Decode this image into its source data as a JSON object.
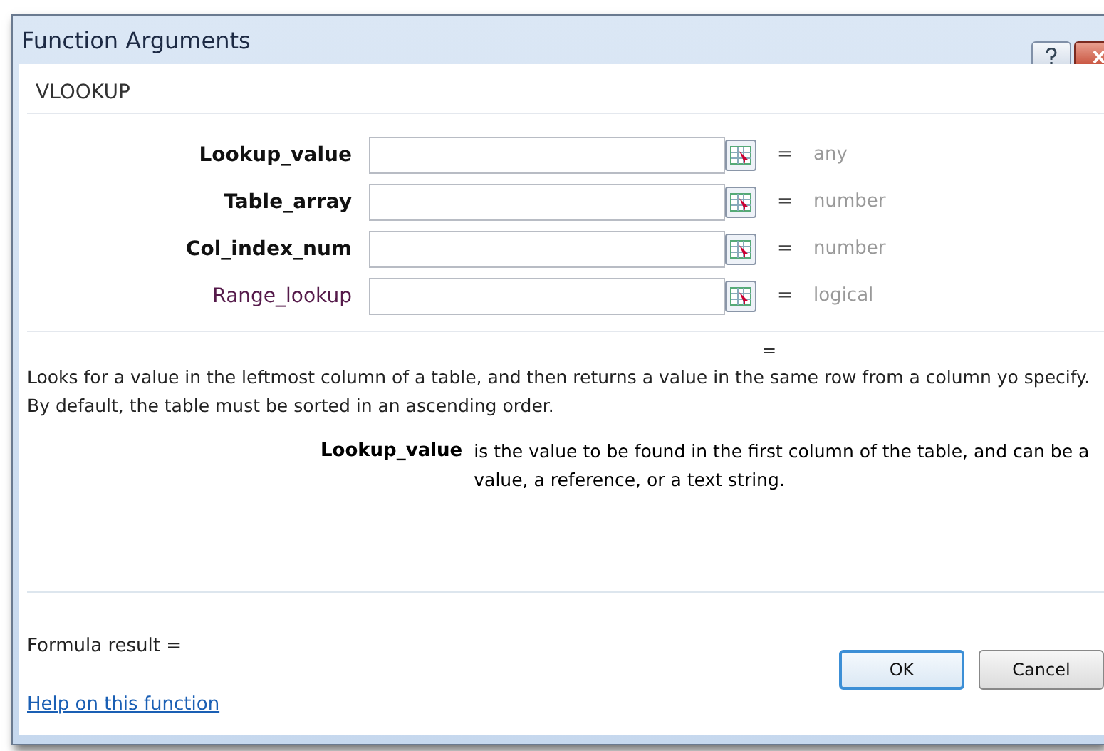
{
  "window": {
    "title": "Function Arguments"
  },
  "function_name": "VLOOKUP",
  "arguments": [
    {
      "name": "Lookup_value",
      "required": true,
      "equals": "=",
      "value_type": "any"
    },
    {
      "name": "Table_array",
      "required": true,
      "equals": "=",
      "value_type": "number"
    },
    {
      "name": "Col_index_num",
      "required": true,
      "equals": "=",
      "value_type": "number"
    },
    {
      "name": "Range_lookup",
      "required": false,
      "equals": "=",
      "value_type": "logical"
    }
  ],
  "result_sign": "=",
  "description": "Looks for a value in the leftmost column of a table, and then returns a value in the same row from a column yo specify. By default, the table must be sorted in an ascending order.",
  "argument_help": {
    "name": "Lookup_value",
    "text": "is the value to be found in the first column of the table, and can be a value, a reference, or a text string."
  },
  "formula_result": "Formula result =",
  "help_link": "Help on this function",
  "buttons": [
    {
      "label": "OK",
      "default": true
    },
    {
      "label": "Cancel",
      "default": false
    }
  ]
}
